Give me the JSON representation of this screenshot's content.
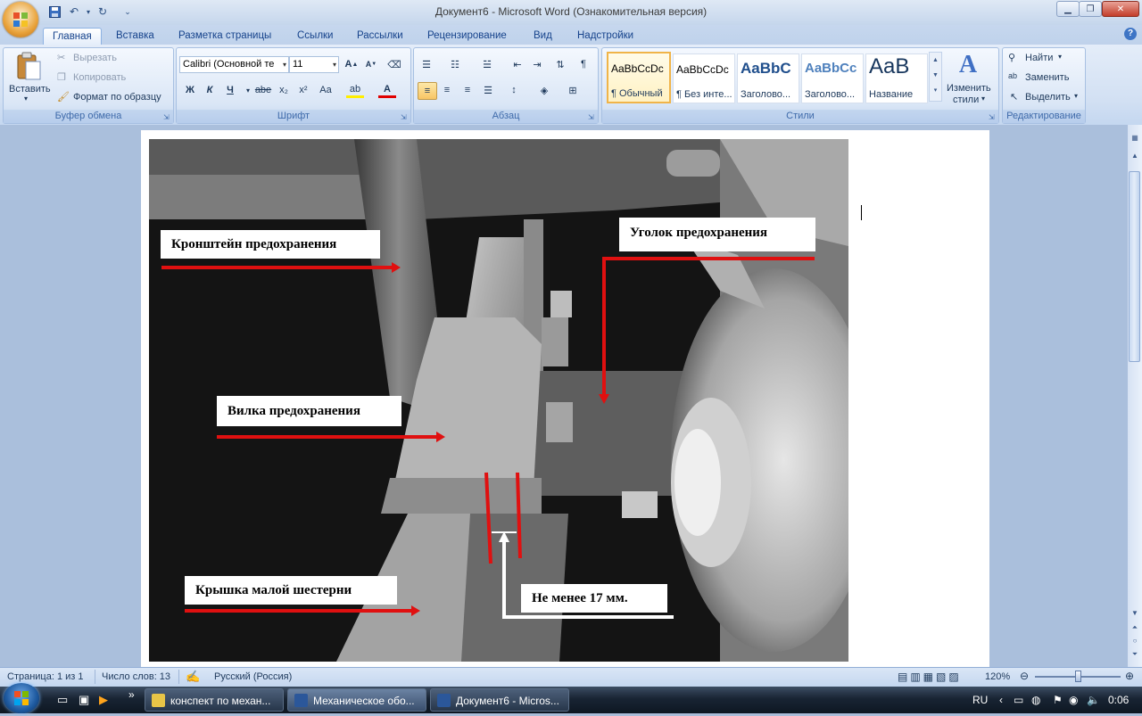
{
  "window": {
    "title": "Документ6 - Microsoft Word (Ознакомительная версия)"
  },
  "ribbon_tabs": [
    "Главная",
    "Вставка",
    "Разметка страницы",
    "Ссылки",
    "Рассылки",
    "Рецензирование",
    "Вид",
    "Надстройки"
  ],
  "clipboard": {
    "paste": "Вставить",
    "cut": "Вырезать",
    "copy": "Копировать",
    "format_painter": "Формат по образцу",
    "label": "Буфер обмена"
  },
  "font": {
    "name": "Calibri (Основной те",
    "size": "11",
    "label": "Шрифт",
    "bold": "Ж",
    "italic": "К",
    "underline": "Ч",
    "strike": "abe",
    "sub": "x₂",
    "sup": "x²",
    "case": "Aa"
  },
  "paragraph": {
    "label": "Абзац"
  },
  "styles": {
    "label": "Стили",
    "items": [
      {
        "sample": "AaBbCcDc",
        "name": "¶ Обычный"
      },
      {
        "sample": "AaBbCcDc",
        "name": "¶ Без инте..."
      },
      {
        "sample": "AaBbC",
        "name": "Заголово..."
      },
      {
        "sample": "AaBbCc",
        "name": "Заголово..."
      },
      {
        "sample": "AaB",
        "name": "Название"
      }
    ],
    "change_line1": "Изменить",
    "change_line2": "стили"
  },
  "editing": {
    "find": "Найти",
    "replace": "Заменить",
    "select": "Выделить",
    "label": "Редактирование"
  },
  "figure_labels": {
    "bracket": "Кронштейн предохранения",
    "corner": "Уголок предохранения",
    "fork": "Вилка предохранения",
    "cover": "Крышка малой шестерни",
    "min_gap": "Не менее 17 мм."
  },
  "status": {
    "page": "Страница: 1 из 1",
    "words": "Число слов: 13",
    "language": "Русский (Россия)",
    "zoom": "120%"
  },
  "taskbar": {
    "items": [
      "конспект по механ...",
      "Механическое обо...",
      "Документ6 - Micros..."
    ],
    "lang": "RU",
    "time": "0:06"
  }
}
